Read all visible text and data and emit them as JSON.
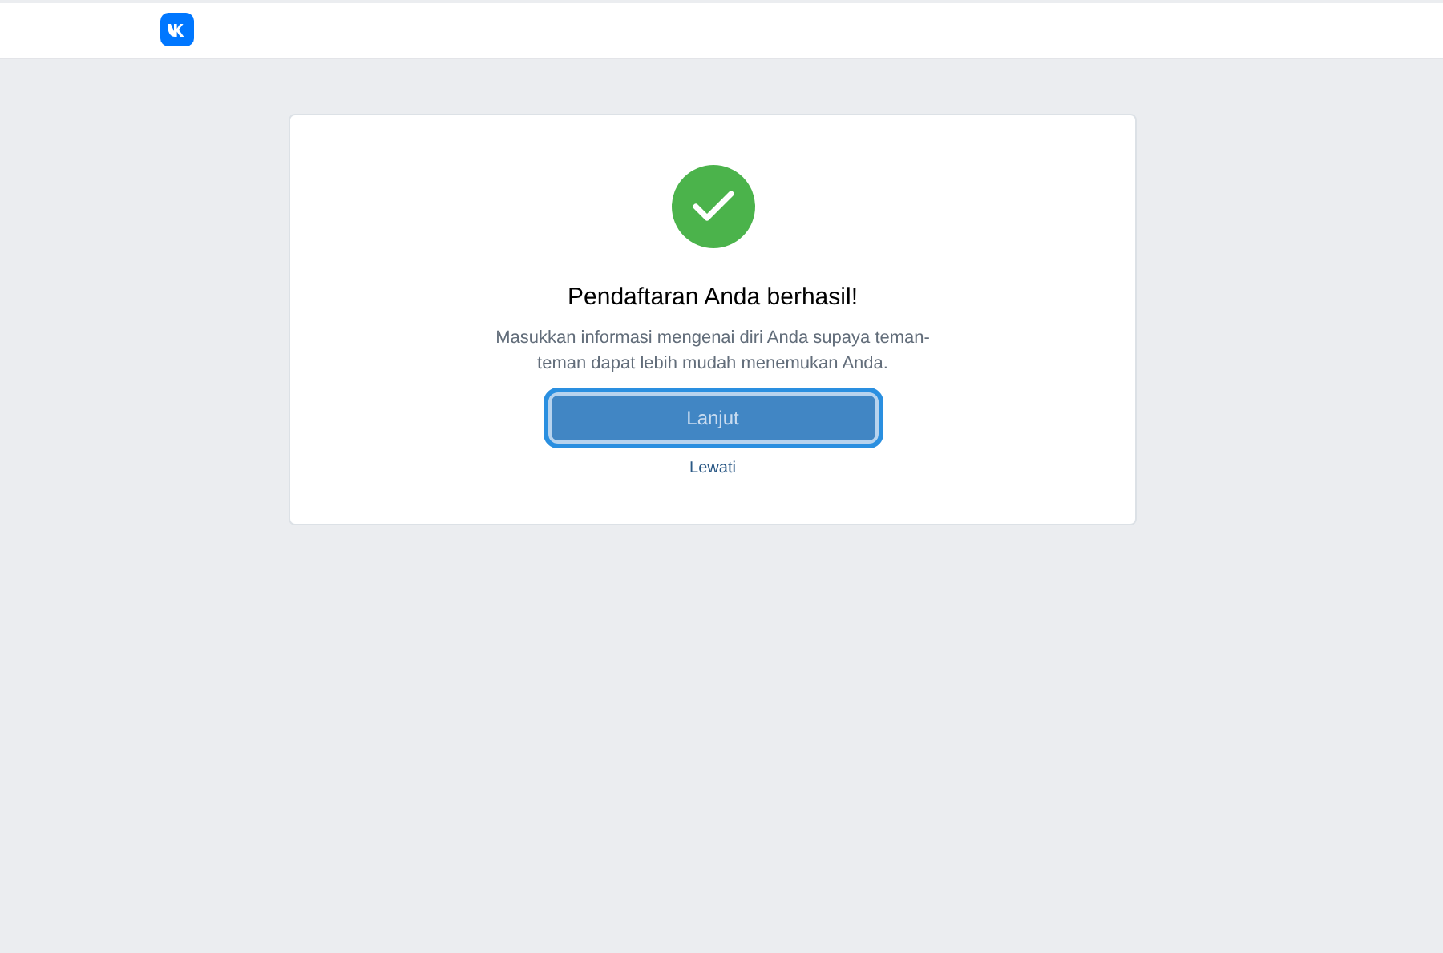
{
  "header": {
    "kind": "logo"
  },
  "card": {
    "title": "Pendaftaran Anda berhasil!",
    "description": "Masukkan informasi mengenai diri Anda supaya teman-teman dapat lebih mudah menemukan Anda.",
    "primary_button": {
      "label": "Lanjut",
      "focused": true
    },
    "skip_link": "Lewati"
  }
}
